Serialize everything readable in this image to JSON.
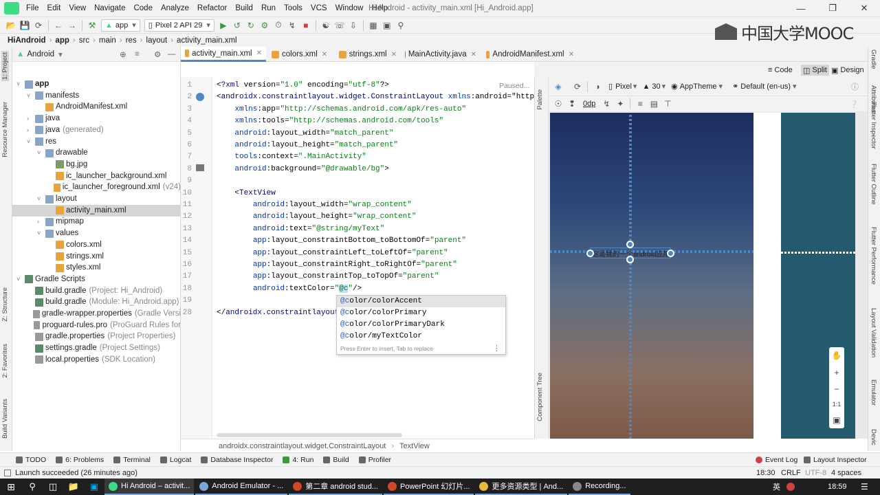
{
  "window": {
    "title": "Hi Android - activity_main.xml [Hi_Android.app]",
    "menu": [
      "File",
      "Edit",
      "View",
      "Navigate",
      "Code",
      "Analyze",
      "Refactor",
      "Build",
      "Run",
      "Tools",
      "VCS",
      "Window",
      "Help"
    ]
  },
  "toolbar": {
    "module": "app",
    "device": "Pixel 2 API 29"
  },
  "breadcrumb": [
    "HiAndroid",
    "app",
    "src",
    "main",
    "res",
    "layout",
    "activity_main.xml"
  ],
  "watermark": "中国大学MOOC",
  "project_panel": {
    "view": "Android",
    "tree": [
      {
        "label": "app",
        "dim": "",
        "icon": "folder-icon"
      },
      {
        "label": "manifests",
        "dim": "",
        "icon": "folder-icon"
      },
      {
        "label": "AndroidManifest.xml",
        "dim": "",
        "icon": "manifest-icon"
      },
      {
        "label": "java",
        "dim": "",
        "icon": "folder-icon"
      },
      {
        "label": "java",
        "dim": "(generated)",
        "icon": "folder-icon"
      },
      {
        "label": "res",
        "dim": "",
        "icon": "folder-icon"
      },
      {
        "label": "drawable",
        "dim": "",
        "icon": "folder-icon"
      },
      {
        "label": "bg.jpg",
        "dim": "",
        "icon": "image-icon"
      },
      {
        "label": "ic_launcher_background.xml",
        "dim": "",
        "icon": "xml-icon"
      },
      {
        "label": "ic_launcher_foreground.xml",
        "dim": "(v24)",
        "icon": "xml-icon"
      },
      {
        "label": "layout",
        "dim": "",
        "icon": "folder-icon"
      },
      {
        "label": "activity_main.xml",
        "dim": "",
        "icon": "xml-icon"
      },
      {
        "label": "mipmap",
        "dim": "",
        "icon": "folder-icon"
      },
      {
        "label": "values",
        "dim": "",
        "icon": "folder-icon"
      },
      {
        "label": "colors.xml",
        "dim": "",
        "icon": "xml-icon"
      },
      {
        "label": "strings.xml",
        "dim": "",
        "icon": "xml-icon"
      },
      {
        "label": "styles.xml",
        "dim": "",
        "icon": "xml-icon"
      },
      {
        "label": "Gradle Scripts",
        "dim": "",
        "icon": "gradle-icon"
      },
      {
        "label": "build.gradle",
        "dim": "(Project: Hi_Android)",
        "icon": "gradle-icon"
      },
      {
        "label": "build.gradle",
        "dim": "(Module: Hi_Android.app)",
        "icon": "gradle-icon"
      },
      {
        "label": "gradle-wrapper.properties",
        "dim": "(Gradle Versi",
        "icon": "file-icon"
      },
      {
        "label": "proguard-rules.pro",
        "dim": "(ProGuard Rules for",
        "icon": "file-icon"
      },
      {
        "label": "gradle.properties",
        "dim": "(Project Properties)",
        "icon": "file-icon"
      },
      {
        "label": "settings.gradle",
        "dim": "(Project Settings)",
        "icon": "gradle-icon"
      },
      {
        "label": "local.properties",
        "dim": "(SDK Location)",
        "icon": "file-icon"
      }
    ]
  },
  "editor_tabs": [
    "activity_main.xml",
    "colors.xml",
    "strings.xml",
    "MainActivity.java",
    "AndroidManifest.xml"
  ],
  "editor": {
    "paused": "Paused...",
    "line_numbers": [
      "1",
      "2",
      "3",
      "4",
      "5",
      "6",
      "7",
      "8",
      "9",
      "10",
      "11",
      "12",
      "13",
      "14",
      "15",
      "16",
      "17",
      "18",
      "19",
      "28"
    ],
    "lines": [
      "<?xml version=\"1.0\" encoding=\"utf-8\"?>",
      "<androidx.constraintlayout.widget.ConstraintLayout xmlns:android=\"http",
      "    xmlns:app=\"http://schemas.android.com/apk/res-auto\"",
      "    xmlns:tools=\"http://schemas.android.com/tools\"",
      "    android:layout_width=\"match_parent\"",
      "    android:layout_height=\"match_parent\"",
      "    tools:context=\".MainActivity\"",
      "    android:background=\"@drawable/bg\">",
      "",
      "    <TextView",
      "        android:layout_width=\"wrap_content\"",
      "        android:layout_height=\"wrap_content\"",
      "        android:text=\"@string/myText\"",
      "        app:layout_constraintBottom_toBottomOf=\"parent\"",
      "        app:layout_constraintLeft_toLeftOf=\"parent\"",
      "        app:layout_constraintRight_toRightOf=\"parent\"",
      "        app:layout_constraintTop_toTopOf=\"parent\"",
      "        android:textColor=\"@c\"/>",
      "",
      "</androidx.constraintlayout"
    ],
    "completion": [
      "@color/colorAccent",
      "@color/colorPrimary",
      "@color/colorPrimaryDark",
      "@color/myTextColor"
    ],
    "completion_hint": "Press Enter to insert, Tab to replace",
    "crumb": [
      "androidx.constraintlayout.widget.ConstraintLayout",
      "TextView"
    ]
  },
  "design": {
    "modes": [
      "Code",
      "Split",
      "Design"
    ],
    "device": "Pixel",
    "api": "30",
    "theme": "AppTheme",
    "locale": "Default (en-us)",
    "margin": "0dp",
    "preview_text": "这是我的一个android应用",
    "zoom": [
      "+",
      "−",
      "1:1"
    ]
  },
  "left_strip": [
    "1: Project",
    "Resource Manager",
    "Z: Structure",
    "2: Favorites",
    "Build Variants"
  ],
  "right_strip": [
    "Gradle",
    "Attributes",
    "Flutter Inspector",
    "Flutter Outline",
    "Flutter Performance",
    "Layout Validation",
    "Emulator",
    "Devic"
  ],
  "design_side": [
    "Palette",
    "Component Tree"
  ],
  "bottom_tabs": [
    "TODO",
    "6: Problems",
    "Terminal",
    "Logcat",
    "Database Inspector",
    "4: Run",
    "Build",
    "Profiler"
  ],
  "bottom_right_tabs": [
    "Event Log",
    "Layout Inspector"
  ],
  "status": {
    "message": "Launch succeeded (26 minutes ago)",
    "position": "18:30",
    "line_sep": "CRLF",
    "encoding": "UTF-8",
    "indent": "4 spaces"
  },
  "taskbar": {
    "items": [
      "Hi Android – activit...",
      "Android Emulator - ...",
      "第二章 android stud...",
      "PowerPoint 幻灯片...",
      "更多资源类型 | And...",
      "Recording..."
    ],
    "ime": "英",
    "clock": "18:59"
  },
  "colors": {
    "accent": "#4a88c7",
    "selection": "#d5d5d5",
    "taskbar": "#1f1f1f"
  }
}
